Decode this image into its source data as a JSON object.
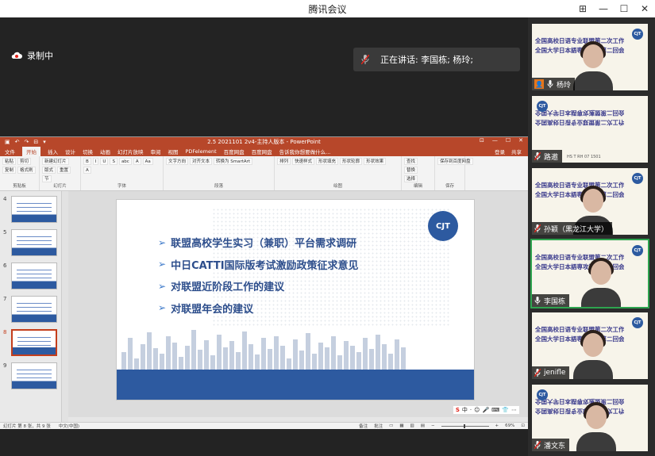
{
  "window": {
    "title": "腾讯会议",
    "controls": [
      "⊞",
      "—",
      "☐",
      "✕"
    ]
  },
  "recording": {
    "label": "录制中"
  },
  "speaking": {
    "text": "正在讲话: 李国栋; 杨玲;"
  },
  "ppt": {
    "title": "2.5 2021101 2v4-主持人版本 - PowerPoint",
    "quick_access": [
      "▣",
      "↶",
      "↷",
      "⊟",
      "▾"
    ],
    "window_controls": [
      "⊡",
      "—",
      "☐",
      "✕"
    ],
    "tabs": [
      "文件",
      "开始",
      "插入",
      "设计",
      "切换",
      "动画",
      "幻灯片放映",
      "审阅",
      "视图",
      "PDFelement",
      "百度网盘",
      "百度网盘",
      "告诉我你想要做什么..."
    ],
    "tabs_right": [
      "登录",
      "共享"
    ],
    "ribbon_groups": [
      {
        "name": "剪贴板",
        "items": [
          "粘贴",
          "剪切",
          "复制",
          "格式刷"
        ]
      },
      {
        "name": "幻灯片",
        "items": [
          "新建幻灯片",
          "版式",
          "重置",
          "节"
        ]
      },
      {
        "name": "字体",
        "items": [
          "B",
          "I",
          "U",
          "S",
          "abc",
          "A",
          "Aa",
          "A"
        ]
      },
      {
        "name": "段落",
        "items": [
          "文字方向",
          "对齐文本",
          "转换为 SmartArt"
        ]
      },
      {
        "name": "绘图",
        "items": [
          "排列",
          "快速样式",
          "形状填充",
          "形状轮廓",
          "形状效果"
        ]
      },
      {
        "name": "编辑",
        "items": [
          "查找",
          "替换",
          "选择"
        ]
      },
      {
        "name": "保存",
        "items": [
          "保存到百度网盘"
        ]
      }
    ],
    "thumbnails": [
      {
        "num": "4",
        "selected": false
      },
      {
        "num": "5",
        "selected": false
      },
      {
        "num": "6",
        "selected": false
      },
      {
        "num": "7",
        "selected": false
      },
      {
        "num": "8",
        "selected": true
      },
      {
        "num": "9",
        "selected": false
      }
    ],
    "slide": {
      "logo": "CJT",
      "bullets": [
        "联盟高校学生实习（兼职）平台需求调研",
        "中日CATTI国际版考试激励政策征求意见",
        "对联盟近阶段工作的建议",
        "对联盟年会的建议"
      ]
    },
    "ime_bar": [
      "S",
      "中",
      "·",
      "☺",
      "🎤",
      "⌨",
      "👕",
      "⋯"
    ],
    "status": {
      "slide_info": "幻灯片 第 8 张，共 9 张",
      "language": "中文(中国)",
      "notes": "备注",
      "comments": "批注",
      "zoom": "69%"
    }
  },
  "participants": [
    {
      "name": "杨玲",
      "host": true,
      "muted": false,
      "bg_line1": "全国高校日语专业联盟第二次工作会议",
      "bg_line2": "全国大学日本語専攻連盟第二回会議",
      "mirrored": false,
      "active": false
    },
    {
      "name": "路邀",
      "host": false,
      "muted": true,
      "bg_line1": "全国高校日语专业联盟第二次工作会议",
      "bg_line2": "全国大学日本語専攻連盟第二回会議",
      "mirrored": true,
      "active": false,
      "small_text": "HS T RH 07 1501"
    },
    {
      "name": "孙颖（黑龙江大学）",
      "host": false,
      "muted": true,
      "bg_line1": "全国高校日语专业联盟第二次工作会议",
      "bg_line2": "全国大学日本語専攻連盟第二回会議",
      "mirrored": false,
      "active": false
    },
    {
      "name": "李国栋",
      "host": false,
      "muted": false,
      "bg_line1": "全国高校日语专业联盟第二次工作会议",
      "bg_line2": "全国大学日本語専攻連盟第二回会議",
      "mirrored": false,
      "active": true
    },
    {
      "name": "jenifle",
      "host": false,
      "muted": true,
      "bg_line1": "全国高校日语专业联盟第二次工作会议",
      "bg_line2": "全国大学日本語専攻連盟第二回会議",
      "mirrored": false,
      "active": false
    },
    {
      "name": "潘文东",
      "host": false,
      "muted": true,
      "bg_line1": "全国高校日语专业联盟第二次工作会议",
      "bg_line2": "全国大学日本語専攻連盟第二回会議",
      "mirrored": true,
      "active": false
    }
  ],
  "colors": {
    "ppt_accent": "#b7472a",
    "slide_blue": "#2d5aa0",
    "active_speaker": "#2ea44f"
  }
}
